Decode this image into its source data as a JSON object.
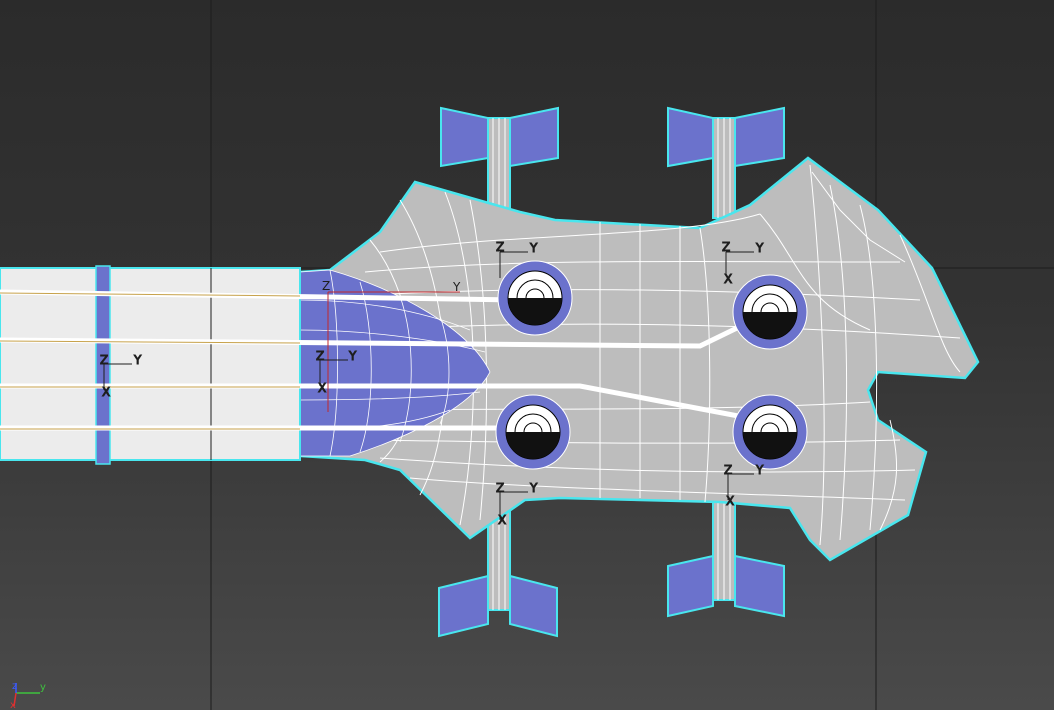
{
  "viewport": {
    "name": "3D viewport - Top view",
    "background_colors": {
      "top": "#2b2b2b",
      "bottom": "#4a4a4a"
    },
    "colors": {
      "mesh_fill": "#bdbdbd",
      "wire": "#ffffff",
      "selection_outline": "#49e6ee",
      "blue_faces": "#6b72cc",
      "neck_fill": "#ececec",
      "grid_line": "#1e1e1e"
    }
  },
  "pivot_gizmos": [
    {
      "z": "Z",
      "y": "Y",
      "x": "X"
    },
    {
      "z": "Z",
      "y": "Y",
      "x": "X"
    },
    {
      "z": "Z",
      "y": "Y",
      "x": "X"
    },
    {
      "z": "Z",
      "y": "Y",
      "x": "X"
    },
    {
      "z": "Z",
      "y": "Y",
      "x": "X"
    },
    {
      "z": "Z",
      "y": "Y",
      "x": "X"
    },
    {
      "z": "Z",
      "y": "Y",
      "x": "X"
    }
  ],
  "world_axis": {
    "z": "z",
    "y": "y",
    "x": "x",
    "colors": {
      "z": "#3b5bff",
      "y": "#3ec23e",
      "x": "#e03030"
    }
  },
  "icons": {
    "world_axis": "world-axis-tripod-icon",
    "pivot": "pivot-gizmo-icon"
  }
}
